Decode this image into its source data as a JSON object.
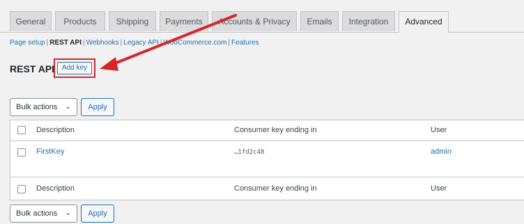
{
  "tabs": [
    {
      "label": "General"
    },
    {
      "label": "Products"
    },
    {
      "label": "Shipping"
    },
    {
      "label": "Payments"
    },
    {
      "label": "Accounts & Privacy"
    },
    {
      "label": "Emails"
    },
    {
      "label": "Integration"
    },
    {
      "label": "Advanced"
    }
  ],
  "active_tab": "Advanced",
  "subnav": {
    "items": [
      "Page setup",
      "REST API",
      "Webhooks",
      "Legacy API",
      "WooCommerce.com",
      "Features"
    ],
    "current": "REST API",
    "separator": "|"
  },
  "heading": {
    "title": "REST API",
    "add_key_label": "Add key"
  },
  "bulk_top": {
    "select_label": "Bulk actions",
    "apply_label": "Apply"
  },
  "bulk_bottom": {
    "select_label": "Bulk actions",
    "apply_label": "Apply"
  },
  "table": {
    "columns": [
      "Description",
      "Consumer key ending in",
      "User"
    ],
    "rows": [
      {
        "description": "FirstKey",
        "key_ending": "…1fd2c48",
        "user": "admin"
      }
    ]
  },
  "colors": {
    "accent": "#2271b1",
    "highlight_red": "#d6262a",
    "background": "#f1f1f1"
  },
  "icons": {
    "dropdown": "chevron-down-icon",
    "annotation": "red-arrow-icon"
  }
}
